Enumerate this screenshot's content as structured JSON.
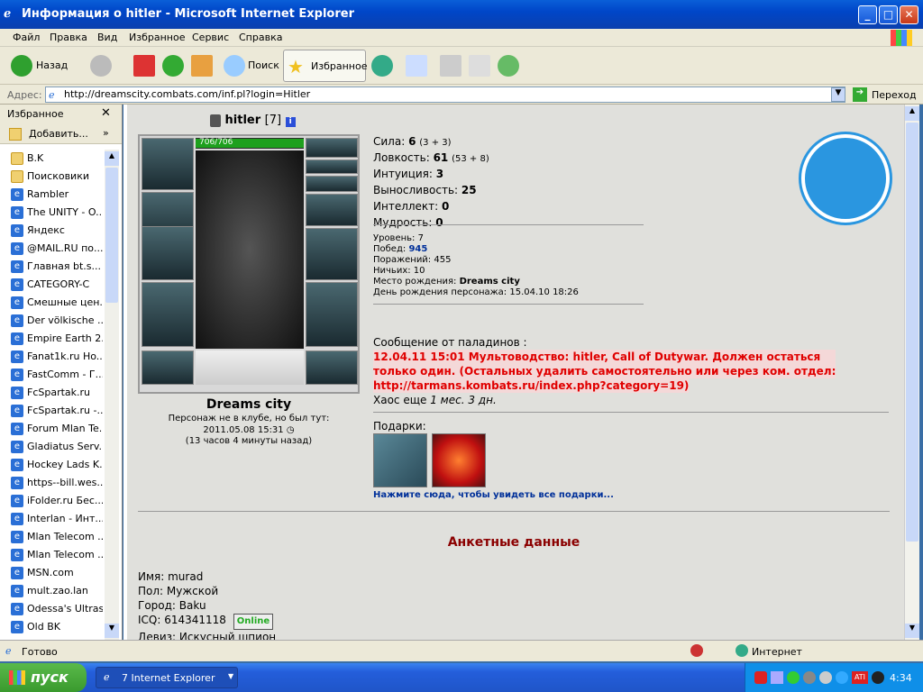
{
  "window": {
    "title": "Информация о hitler - Microsoft Internet Explorer",
    "btn_min": "_",
    "btn_max": "□",
    "btn_close": "✕"
  },
  "menu": [
    "Файл",
    "Правка",
    "Вид",
    "Избранное",
    "Сервис",
    "Справка"
  ],
  "toolbar": {
    "back": "Назад",
    "search": "Поиск",
    "favorites": "Избранное"
  },
  "address": {
    "label": "Адрес:",
    "url": "http://dreamscity.combats.com/inf.pl?login=Hitler",
    "go": "Переход"
  },
  "favorites": {
    "title": "Избранное",
    "add": "Добавить...",
    "items": [
      {
        "label": "B.K",
        "folder": true
      },
      {
        "label": "Поисковики",
        "folder": true
      },
      {
        "label": "Rambler"
      },
      {
        "label": "The UNITY - O..."
      },
      {
        "label": "Яндекс"
      },
      {
        "label": "@MAIL.RU по..."
      },
      {
        "label": "Главная  bt.s..."
      },
      {
        "label": "CATEGORY-C"
      },
      {
        "label": "Смешные цен..."
      },
      {
        "label": "Der völkische ..."
      },
      {
        "label": "Empire Earth 2..."
      },
      {
        "label": "Fanat1k.ru Ho..."
      },
      {
        "label": "FastComm - Г..."
      },
      {
        "label": "FcSpartak.ru"
      },
      {
        "label": "FcSpartak.ru -..."
      },
      {
        "label": "Forum Mlan Te..."
      },
      {
        "label": "Gladiatus Serv..."
      },
      {
        "label": "Hockey Lads K..."
      },
      {
        "label": "https--bill.wes..."
      },
      {
        "label": "iFolder.ru Бес..."
      },
      {
        "label": "Interlan - Инт..."
      },
      {
        "label": "Mlan Telecom ..."
      },
      {
        "label": "Mlan Telecom ..."
      },
      {
        "label": "MSN.com"
      },
      {
        "label": "mult.zao.lan"
      },
      {
        "label": "Odessa's Ultras"
      },
      {
        "label": "Old BK"
      }
    ]
  },
  "char": {
    "name": "hitler",
    "level": "[7]",
    "hp": "706/706",
    "city": "Dreams city",
    "clan_status": "Персонаж не в клубе, но был тут:",
    "last_seen": "2011.05.08 15:31",
    "ago": "(13 часов 4 минуты назад)"
  },
  "stats": [
    {
      "label": "Сила:",
      "value": "6",
      "extra": "(3 + 3)"
    },
    {
      "label": "Ловкость:",
      "value": "61",
      "extra": "(53 + 8)"
    },
    {
      "label": "Интуиция:",
      "value": "3",
      "extra": ""
    },
    {
      "label": "Выносливость:",
      "value": "25",
      "extra": ""
    },
    {
      "label": "Интеллект:",
      "value": "0",
      "extra": ""
    },
    {
      "label": "Мудрость:",
      "value": "0",
      "extra": ""
    }
  ],
  "info": {
    "level": "Уровень: 7",
    "wins_label": "Побед:",
    "wins": "945",
    "losses": "Поражений: 455",
    "draws": "Ничьих: 10",
    "birthplace_label": "Место рождения:",
    "birthplace": "Dreams city",
    "birthday": "День рождения персонажа: 15.04.10 18:26"
  },
  "message": {
    "header": "Сообщение от паладинов :",
    "line1": "12.04.11 15:01 Мультоводство: hitler, Call of Dutywar. Должен остаться",
    "line2": "только один. (Остальных удалить самостоятельно или через ком. отдел:",
    "line3": "http://tarmans.kombats.ru/index.php?category=19)",
    "chaos_label": "Хаос еще",
    "chaos": "1 мес. 3 дн."
  },
  "gifts": {
    "label": "Подарки:",
    "link": "Нажмите сюда, чтобы увидеть все подарки..."
  },
  "anketa": {
    "title": "Анкетные данные",
    "name": "Имя: murad",
    "sex": "Пол: Мужской",
    "city": "Город: Baku",
    "icq": "ICQ: 614341118",
    "online": "Online",
    "motto": "Девиз: Искусный шпион"
  },
  "status": {
    "ready": "Готово",
    "zone": "Интернет"
  },
  "taskbar": {
    "start": "пуск",
    "task": "7 Internet Explorer",
    "clock": "4:34"
  },
  "colors": {
    "accent": "#0a5fd8",
    "message_red": "#e00000",
    "anketa_title": "#8b0000"
  }
}
